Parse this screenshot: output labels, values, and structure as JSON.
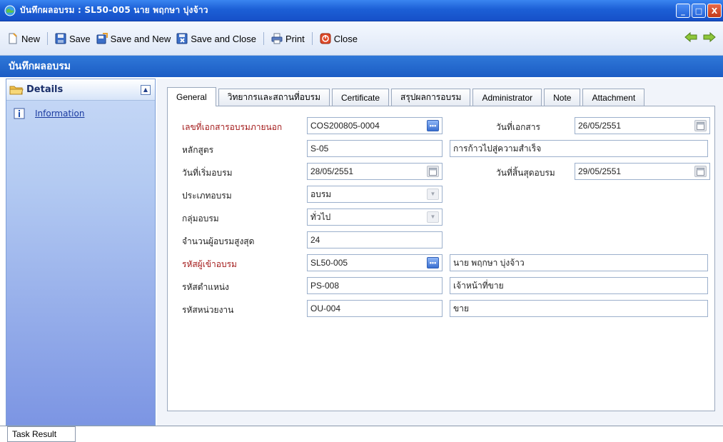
{
  "window": {
    "title": "บันทึกผลอบรม : SL50-005 นาย พฤกษา บุ่งจ้าว"
  },
  "toolbar": {
    "new_label": "New",
    "save_label": "Save",
    "save_new_label": "Save and New",
    "save_close_label": "Save and Close",
    "print_label": "Print",
    "close_label": "Close"
  },
  "section": {
    "title": "บันทึกผลอบรม"
  },
  "sidebar": {
    "header": "Details",
    "items": [
      {
        "label": "Information"
      }
    ]
  },
  "tabs": [
    {
      "label": "General"
    },
    {
      "label": "วิทยากรและสถานที่อบรม"
    },
    {
      "label": "Certificate"
    },
    {
      "label": "สรุปผลการอบรม"
    },
    {
      "label": "Administrator"
    },
    {
      "label": "Note"
    },
    {
      "label": "Attachment"
    }
  ],
  "form": {
    "doc_no_label": "เลขที่เอกสารอบรมภายนอก",
    "doc_no_value": "COS200805-0004",
    "doc_date_label": "วันที่เอกสาร",
    "doc_date_value": "26/05/2551",
    "course_label": "หลักสูตร",
    "course_code": "S-05",
    "course_name": "การก้าวไปสู่ความสำเร็จ",
    "start_label": "วันที่เริ่มอบรม",
    "start_value": "28/05/2551",
    "end_label": "วันที่สิ้นสุดอบรม",
    "end_value": "29/05/2551",
    "type_label": "ประเภทอบรม",
    "type_value": "อบรม",
    "group_label": "กลุ่มอบรม",
    "group_value": "ทั่วไป",
    "max_label": "จำนวนผู้อบรมสูงสุด",
    "max_value": "24",
    "trainee_label": "รหัสผู้เข้าอบรม",
    "trainee_code": "SL50-005",
    "trainee_name": "นาย พฤกษา บุ่งจ้าว",
    "position_label": "รหัสตำแหน่ง",
    "position_code": "PS-008",
    "position_name": "เจ้าหน้าที่ขาย",
    "unit_label": "รหัสหน่วยงาน",
    "unit_code": "OU-004",
    "unit_name": "ขาย"
  },
  "bottom": {
    "tab_label": "Task Result"
  }
}
